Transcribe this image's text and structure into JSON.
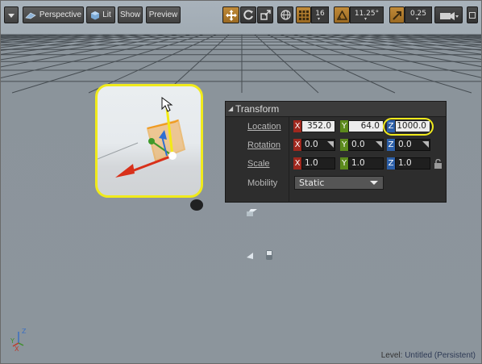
{
  "toolbar": {
    "perspective_label": "Perspective",
    "lit_label": "Lit",
    "show_label": "Show",
    "preview_label": "Preview",
    "grid_snap_value": "16",
    "rotation_snap_value": "11.25°",
    "scale_snap_value": "0.25"
  },
  "transform": {
    "title": "Transform",
    "location": {
      "label": "Location",
      "x": "352.0",
      "y": "64.0",
      "z": "1000.0"
    },
    "rotation": {
      "label": "Rotation",
      "x": "0.0",
      "y": "0.0",
      "z": "0.0"
    },
    "scale": {
      "label": "Scale",
      "x": "1.0",
      "y": "1.0",
      "z": "1.0"
    },
    "mobility": {
      "label": "Mobility",
      "value": "Static"
    }
  },
  "axis_letters": {
    "x": "X",
    "y": "Y",
    "z": "Z"
  },
  "level": {
    "prefix": "Level:",
    "name": "Untitled (Persistent)"
  },
  "colors": {
    "highlight": "#f0ea1c",
    "x_axis": "#a0281e",
    "y_axis": "#5c8a1c",
    "z_axis": "#2c5fa8",
    "toolbar_selected": "#c08a38",
    "panel_bg": "#2d2d2d"
  },
  "icons": [
    "dropdown-menu-icon",
    "perspective-icon",
    "lit-cube-icon",
    "translate-mode-icon",
    "rotate-mode-icon",
    "scale-mode-icon",
    "world-local-icon",
    "grid-snap-icon",
    "rotation-snap-icon",
    "scale-snap-icon",
    "camera-speed-icon",
    "maximize-icon",
    "lock-icon",
    "mouse-cursor-icon",
    "axis-indicator-icon"
  ]
}
